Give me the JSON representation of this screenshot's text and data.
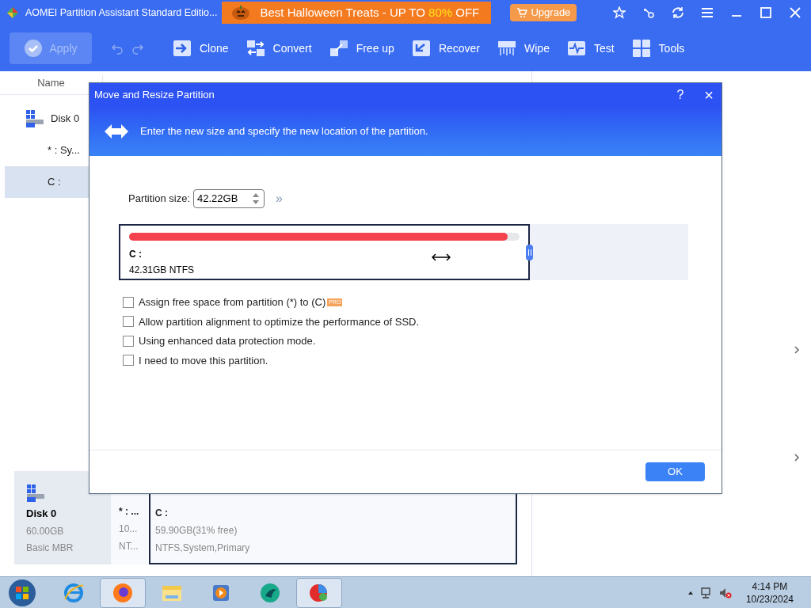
{
  "window": {
    "title": "AOMEI Partition Assistant Standard Editio..."
  },
  "promo": {
    "text": "Best Halloween Treats - UP TO ",
    "highlight": "80%",
    "suffix": " OFF"
  },
  "upgrade": {
    "label": "Upgrade"
  },
  "toolbar": [
    {
      "kind": "apply",
      "label": "Apply",
      "disabled": true
    },
    {
      "kind": "undo",
      "disabled": true
    },
    {
      "kind": "redo",
      "disabled": true
    },
    {
      "kind": "clone",
      "label": "Clone",
      "disabled": false
    },
    {
      "kind": "convert",
      "label": "Convert",
      "disabled": false
    },
    {
      "kind": "freeup",
      "label": "Free up",
      "disabled": false
    },
    {
      "kind": "recover",
      "label": "Recover",
      "disabled": false
    },
    {
      "kind": "wipe",
      "label": "Wipe",
      "disabled": false
    },
    {
      "kind": "test",
      "label": "Test",
      "disabled": false
    },
    {
      "kind": "tools",
      "label": "Tools",
      "disabled": false
    }
  ],
  "table": {
    "columns": [
      "Name"
    ],
    "rows": [
      {
        "kind": "disk",
        "name": "Disk 0",
        "selected": false
      },
      {
        "kind": "partition",
        "name": "* : Sy...",
        "selected": false
      },
      {
        "kind": "partition",
        "name": "C :",
        "selected": true
      }
    ]
  },
  "disk_map": {
    "disk": {
      "name": "Disk 0",
      "size": "60.00GB",
      "type": "Basic MBR"
    },
    "partitions": [
      {
        "name": "* : ...",
        "size": "10...",
        "info": "NT...",
        "selected": false
      },
      {
        "name": "C :",
        "size": "59.90GB(31% free)",
        "info": "NTFS,System,Primary",
        "selected": true
      }
    ]
  },
  "dialog": {
    "title": "Move and Resize Partition",
    "help": "?",
    "close": "×",
    "description": "Enter the new size and specify the new location of the partition.",
    "size_label": "Partition size:",
    "size_value": "42.22GB",
    "more": "»",
    "partition": {
      "name": "C :",
      "info": "42.31GB NTFS",
      "level": 0.97
    },
    "options": [
      {
        "label": "Assign free space from partition (*) to (C)",
        "badge": "PRO",
        "checked": false
      },
      {
        "label": "Allow partition alignment to optimize the performance of SSD.",
        "checked": false
      },
      {
        "label": "Using enhanced data protection mode.",
        "checked": false
      },
      {
        "label": "I need to move this partition.",
        "checked": false
      }
    ],
    "ok": "OK"
  },
  "taskbar": {
    "apps": [
      {
        "kind": "ie",
        "active": false
      },
      {
        "kind": "firefox",
        "active": true
      },
      {
        "kind": "explorer",
        "active": false
      },
      {
        "kind": "media",
        "active": false
      },
      {
        "kind": "green",
        "active": false
      },
      {
        "kind": "aomei",
        "active": true
      }
    ],
    "time": "4:14 PM",
    "date": "10/23/2024"
  }
}
